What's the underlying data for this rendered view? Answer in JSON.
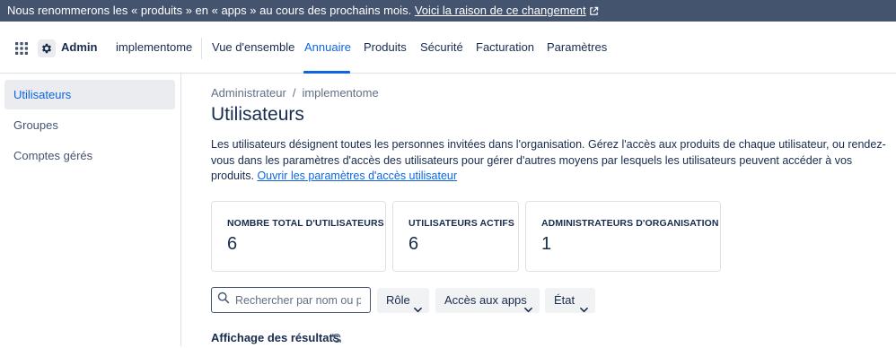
{
  "banner": {
    "text": "Nous renommerons les « produits » en « apps » au cours des prochains mois.",
    "link": "Voici la raison de ce changement",
    "link_icon": "external-link-icon"
  },
  "topnav": {
    "apps_icon": "app-switcher-icon",
    "logo_icon": "gear-icon",
    "admin_label": "Admin",
    "org_name": "implementome",
    "tabs": [
      {
        "label": "Vue d'ensemble",
        "active": false
      },
      {
        "label": "Annuaire",
        "active": true
      },
      {
        "label": "Produits",
        "active": false
      },
      {
        "label": "Sécurité",
        "active": false
      },
      {
        "label": "Facturation",
        "active": false
      },
      {
        "label": "Paramètres",
        "active": false
      }
    ],
    "accent_color": "#0c66e4"
  },
  "sidebar": {
    "items": [
      {
        "label": "Utilisateurs",
        "active": true
      },
      {
        "label": "Groupes",
        "active": false
      },
      {
        "label": "Comptes gérés",
        "active": false
      }
    ]
  },
  "breadcrumb": {
    "items": [
      "Administrateur",
      "implementome"
    ],
    "separator": "/"
  },
  "page": {
    "title": "Utilisateurs",
    "description": "Les utilisateurs désignent toutes les personnes invitées dans l'organisation. Gérez l'accès aux produits de chaque utilisateur, ou rendez-vous dans les paramètres d'accès des utilisateurs pour gérer d'autres moyens par lesquels les utilisateurs peuvent accéder à vos produits.",
    "description_link": "Ouvrir les paramètres d'accès utilisateur"
  },
  "stats": [
    {
      "label": "NOMBRE TOTAL D'UTILISATEURS",
      "value": "6"
    },
    {
      "label": "UTILISATEURS ACTIFS",
      "value": "6"
    },
    {
      "label": "ADMINISTRATEURS D'ORGANISATION",
      "value": "1"
    }
  ],
  "filters": {
    "search_placeholder": "Rechercher par nom ou p…",
    "search_value": "",
    "search_icon": "search-icon",
    "dropdowns": [
      {
        "label": "Rôle"
      },
      {
        "label": "Accès aux apps"
      },
      {
        "label": "État"
      }
    ]
  },
  "results": {
    "label": "Affichage des résultats",
    "icon": "refresh-icon"
  }
}
